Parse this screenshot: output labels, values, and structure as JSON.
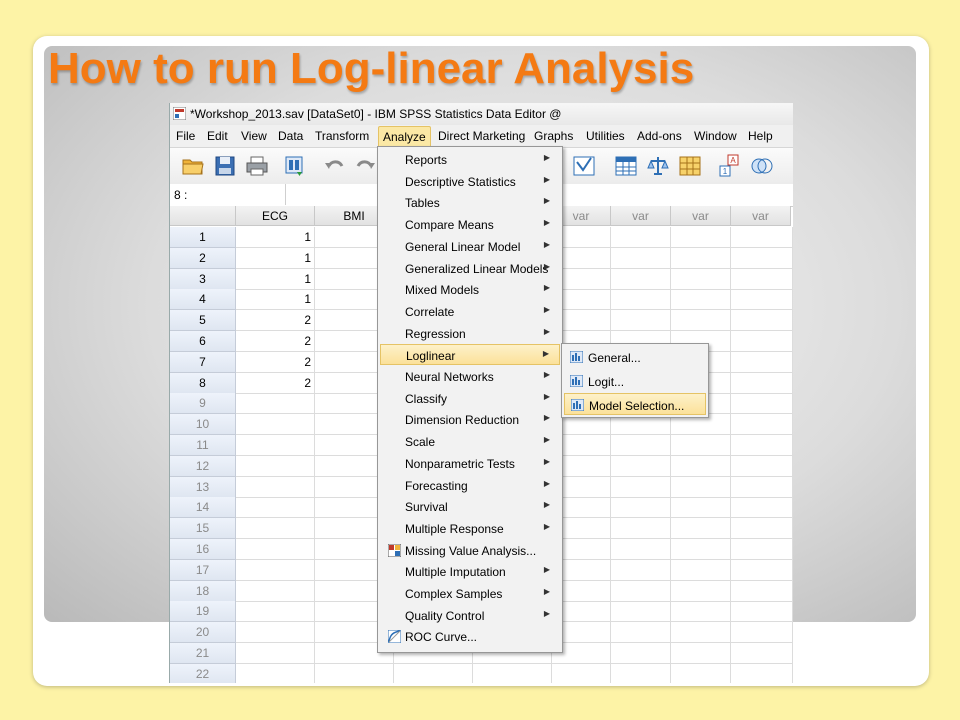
{
  "slide": {
    "title": "How to run Log-linear Analysis"
  },
  "window": {
    "title": "*Workshop_2013.sav [DataSet0] - IBM SPSS Statistics Data Editor @"
  },
  "menubar": [
    "File",
    "Edit",
    "View",
    "Data",
    "Transform",
    "Analyze",
    "Direct Marketing",
    "Graphs",
    "Utilities",
    "Add-ons",
    "Window",
    "Help"
  ],
  "cell_ref": "8 :",
  "columns": [
    "ECG",
    "BMI",
    "var",
    "var",
    "var",
    "var"
  ],
  "rows": [
    {
      "n": "1",
      "ecg": "1"
    },
    {
      "n": "2",
      "ecg": "1"
    },
    {
      "n": "3",
      "ecg": "1"
    },
    {
      "n": "4",
      "ecg": "1"
    },
    {
      "n": "5",
      "ecg": "2"
    },
    {
      "n": "6",
      "ecg": "2"
    },
    {
      "n": "7",
      "ecg": "2"
    },
    {
      "n": "8",
      "ecg": "2"
    },
    {
      "n": "9",
      "ecg": ""
    },
    {
      "n": "10",
      "ecg": ""
    },
    {
      "n": "11",
      "ecg": ""
    },
    {
      "n": "12",
      "ecg": ""
    },
    {
      "n": "13",
      "ecg": ""
    },
    {
      "n": "14",
      "ecg": ""
    },
    {
      "n": "15",
      "ecg": ""
    },
    {
      "n": "16",
      "ecg": ""
    },
    {
      "n": "17",
      "ecg": ""
    },
    {
      "n": "18",
      "ecg": ""
    },
    {
      "n": "19",
      "ecg": ""
    },
    {
      "n": "20",
      "ecg": ""
    },
    {
      "n": "21",
      "ecg": ""
    },
    {
      "n": "22",
      "ecg": ""
    }
  ],
  "analyze_menu": [
    {
      "label": "Reports",
      "submenu": true
    },
    {
      "label": "Descriptive Statistics",
      "submenu": true
    },
    {
      "label": "Tables",
      "submenu": true
    },
    {
      "label": "Compare Means",
      "submenu": true
    },
    {
      "label": "General Linear Model",
      "submenu": true
    },
    {
      "label": "Generalized Linear Models",
      "submenu": true
    },
    {
      "label": "Mixed Models",
      "submenu": true
    },
    {
      "label": "Correlate",
      "submenu": true
    },
    {
      "label": "Regression",
      "submenu": true
    },
    {
      "label": "Loglinear",
      "submenu": true
    },
    {
      "label": "Neural Networks",
      "submenu": true
    },
    {
      "label": "Classify",
      "submenu": true
    },
    {
      "label": "Dimension Reduction",
      "submenu": true
    },
    {
      "label": "Scale",
      "submenu": true
    },
    {
      "label": "Nonparametric Tests",
      "submenu": true
    },
    {
      "label": "Forecasting",
      "submenu": true
    },
    {
      "label": "Survival",
      "submenu": true
    },
    {
      "label": "Multiple Response",
      "submenu": true
    },
    {
      "label": "Missing Value Analysis...",
      "submenu": false
    },
    {
      "label": "Multiple Imputation",
      "submenu": true
    },
    {
      "label": "Complex Samples",
      "submenu": true
    },
    {
      "label": "Quality Control",
      "submenu": true
    },
    {
      "label": "ROC Curve...",
      "submenu": false
    }
  ],
  "highlighted_menu_item": "Loglinear",
  "loglinear_submenu": [
    "General...",
    "Logit...",
    "Model Selection..."
  ],
  "highlighted_submenu_item": "Model Selection...",
  "icons": [
    "open-file-icon",
    "save-icon",
    "print-icon",
    "recall-dialog-icon",
    "undo-icon",
    "redo-icon",
    "variables-icon",
    "data-view-icon",
    "weight-cases-icon",
    "select-cases-icon",
    "value-labels-icon",
    "use-sets-icon"
  ],
  "colors": {
    "title": "#f47a13",
    "highlight": "#fbe19a",
    "background": "#fdf3a6"
  }
}
